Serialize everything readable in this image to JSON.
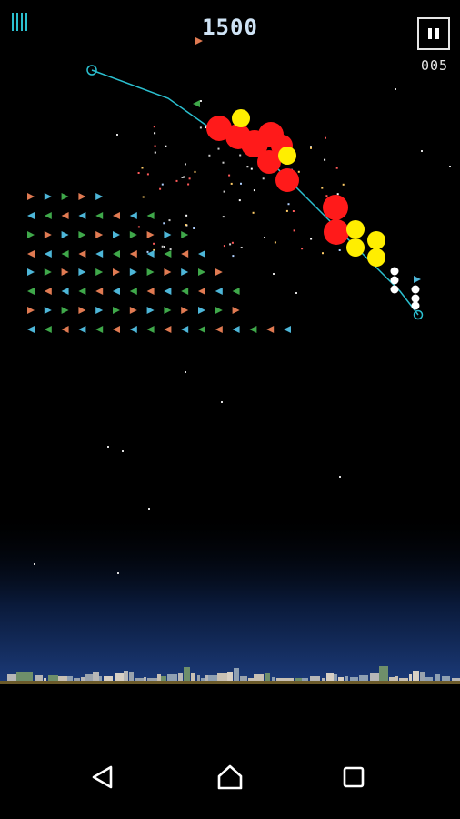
{
  "hud": {
    "score": "1500",
    "counter": "005",
    "lives": 4
  },
  "icons": {
    "pause": "pause-icon",
    "back": "back-triangle-icon",
    "home": "home-icon",
    "recents": "recents-square-icon"
  },
  "colors": {
    "background": "#000000",
    "sky_glow": "#1b3a78",
    "ground": "#6b5a2a",
    "trajectory": "#2bc0d0",
    "enemy_orange": "#e07a52",
    "enemy_cyan": "#4db6d8",
    "enemy_green": "#3fa84a",
    "blast_red": "#ff1a1a",
    "blast_yellow": "#ffee00",
    "blast_white": "#ffffff"
  }
}
